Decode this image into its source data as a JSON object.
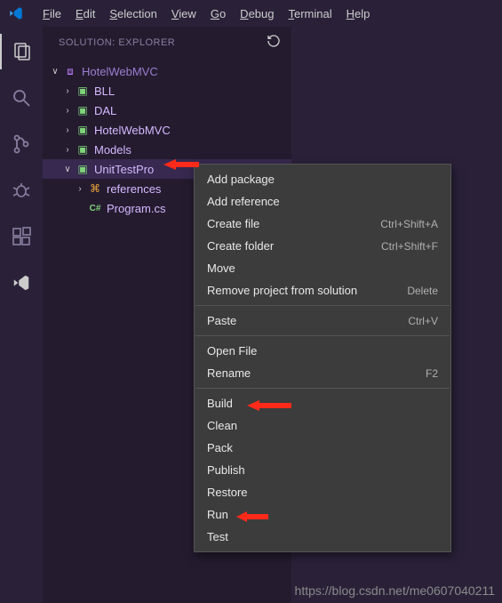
{
  "menubar": {
    "items": [
      {
        "label": "File",
        "ul": "F"
      },
      {
        "label": "Edit",
        "ul": "E"
      },
      {
        "label": "Selection",
        "ul": "S"
      },
      {
        "label": "View",
        "ul": "V"
      },
      {
        "label": "Go",
        "ul": "G"
      },
      {
        "label": "Debug",
        "ul": "D"
      },
      {
        "label": "Terminal",
        "ul": "T"
      },
      {
        "label": "Help",
        "ul": "H"
      }
    ]
  },
  "sidebar": {
    "title": "SOLUTION: EXPLORER",
    "root": "HotelWebMVC",
    "folders": {
      "bll": "BLL",
      "dal": "DAL",
      "web": "HotelWebMVC",
      "models": "Models",
      "unit": "UnitTestPro",
      "refs": "references",
      "program": "Program.cs"
    }
  },
  "context_menu": {
    "groups": [
      [
        {
          "label": "Add package",
          "shortcut": ""
        },
        {
          "label": "Add reference",
          "shortcut": ""
        },
        {
          "label": "Create file",
          "shortcut": "Ctrl+Shift+A"
        },
        {
          "label": "Create folder",
          "shortcut": "Ctrl+Shift+F"
        },
        {
          "label": "Move",
          "shortcut": ""
        },
        {
          "label": "Remove project from solution",
          "shortcut": "Delete"
        }
      ],
      [
        {
          "label": "Paste",
          "shortcut": "Ctrl+V"
        }
      ],
      [
        {
          "label": "Open File",
          "shortcut": ""
        },
        {
          "label": "Rename",
          "shortcut": "F2"
        }
      ],
      [
        {
          "label": "Build",
          "shortcut": ""
        },
        {
          "label": "Clean",
          "shortcut": ""
        },
        {
          "label": "Pack",
          "shortcut": ""
        },
        {
          "label": "Publish",
          "shortcut": ""
        },
        {
          "label": "Restore",
          "shortcut": ""
        },
        {
          "label": "Run",
          "shortcut": ""
        },
        {
          "label": "Test",
          "shortcut": ""
        }
      ]
    ]
  },
  "watermark": "https://blog.csdn.net/me0607040211"
}
